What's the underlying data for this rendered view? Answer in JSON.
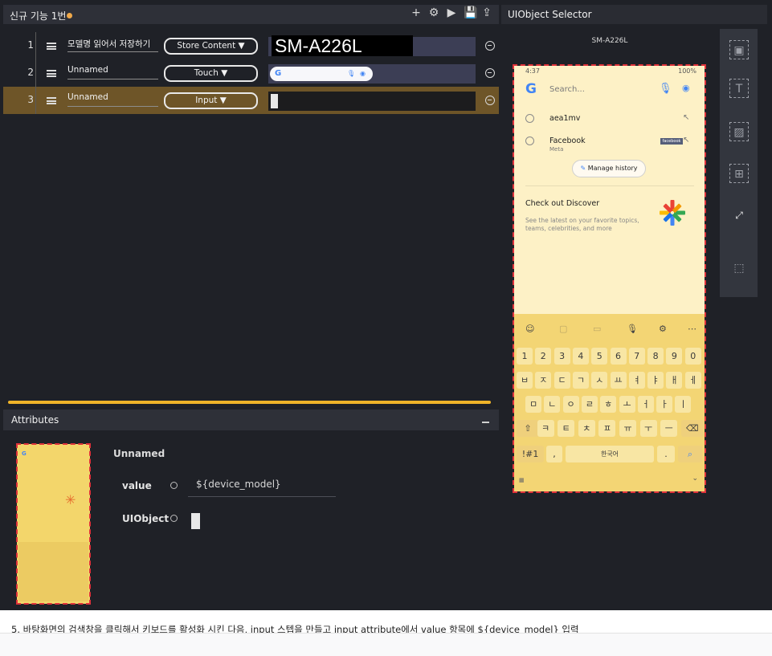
{
  "editor": {
    "title": "신규 기능 1번",
    "toolbar": [
      "+",
      "⚙",
      "▶",
      "💾",
      "⇪"
    ],
    "steps": [
      {
        "num": "1",
        "name": "모델명 읽어서 저장하기",
        "action": "Store Content ▼",
        "target_text": "SM-A226L"
      },
      {
        "num": "2",
        "name": "Unnamed",
        "action": "Touch ▼",
        "target_text": "G"
      },
      {
        "num": "3",
        "name": "Unnamed",
        "action": "Input ▼",
        "target_text": ""
      }
    ]
  },
  "attributes": {
    "title": "Attributes",
    "step_name": "Unnamed",
    "value_label": "value",
    "value": "${device_model}",
    "uiobject_label": "UIObject"
  },
  "selector": {
    "title": "UIObject Selector",
    "device_name": "SM-A226L",
    "phone": {
      "time": "4:37",
      "battery": "100%",
      "search_placeholder": "Search...",
      "suggestions": [
        {
          "text": "aea1mv",
          "sub": ""
        },
        {
          "text": "Facebook",
          "sub": "Meta"
        }
      ],
      "facebook_badge": "facebook",
      "manage_history": "Manage history",
      "discover_title": "Check out Discover",
      "discover_sub": "See the latest on your favorite topics, teams, celebrities, and more",
      "keyboard": {
        "numbers": [
          "1",
          "2",
          "3",
          "4",
          "5",
          "6",
          "7",
          "8",
          "9",
          "0"
        ],
        "row1": [
          "ㅂ",
          "ㅈ",
          "ㄷ",
          "ㄱ",
          "ㅅ",
          "ㅛ",
          "ㅕ",
          "ㅑ",
          "ㅐ",
          "ㅔ"
        ],
        "row2": [
          "ㅁ",
          "ㄴ",
          "ㅇ",
          "ㄹ",
          "ㅎ",
          "ㅗ",
          "ㅓ",
          "ㅏ",
          "ㅣ"
        ],
        "row3": [
          "⇧",
          "ㅋ",
          "ㅌ",
          "ㅊ",
          "ㅍ",
          "ㅠ",
          "ㅜ",
          "ㅡ",
          "⌫"
        ],
        "symbols": "!#1",
        "space": "한국어"
      }
    }
  },
  "caption": {
    "before": "5. 바탕화면의 검색창을 클릭해서 키보드를 활성화 시킨 다음, input 스텝을 만들고 input attribute에서 value 항목에 $",
    "spell": "{device_model}",
    "after": " 입력"
  }
}
